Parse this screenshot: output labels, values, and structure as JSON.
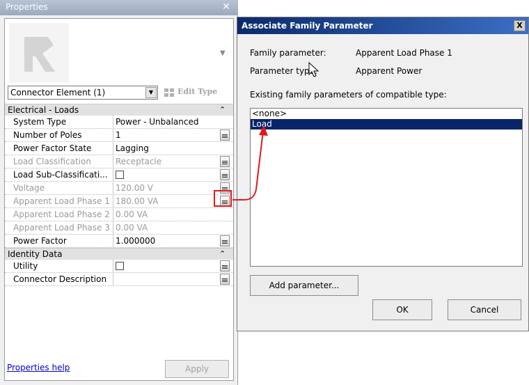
{
  "properties": {
    "title": "Properties",
    "close_glyph": "✕",
    "type_selector": "Connector Element (1)",
    "edit_type_label": "Edit Type",
    "groups": [
      {
        "label": "Electrical - Loads",
        "collapse_glyph": "⌃",
        "rows": [
          {
            "name": "System Type",
            "value": "Power - Unbalanced",
            "enabled": true,
            "has_button": false,
            "checkbox": false
          },
          {
            "name": "Number of Poles",
            "value": "1",
            "enabled": true,
            "has_button": true,
            "checkbox": false
          },
          {
            "name": "Power Factor State",
            "value": "Lagging",
            "enabled": true,
            "has_button": false,
            "checkbox": false
          },
          {
            "name": "Load Classification",
            "value": "Receptacle",
            "enabled": false,
            "has_button": true,
            "checkbox": false
          },
          {
            "name": "Load Sub-Classificati...",
            "value": "",
            "enabled": true,
            "has_button": true,
            "checkbox": true
          },
          {
            "name": "Voltage",
            "value": "120.00 V",
            "enabled": false,
            "has_button": true,
            "checkbox": false
          },
          {
            "name": "Apparent Load Phase 1",
            "value": "180.00 VA",
            "enabled": false,
            "has_button": true,
            "checkbox": false
          },
          {
            "name": "Apparent Load Phase 2",
            "value": "0.00 VA",
            "enabled": false,
            "has_button": false,
            "checkbox": false
          },
          {
            "name": "Apparent Load Phase 3",
            "value": "0.00 VA",
            "enabled": false,
            "has_button": false,
            "checkbox": false
          },
          {
            "name": "Power Factor",
            "value": "1.000000",
            "enabled": true,
            "has_button": true,
            "checkbox": false
          }
        ]
      },
      {
        "label": "Identity Data",
        "collapse_glyph": "⌃",
        "rows": [
          {
            "name": "Utility",
            "value": "",
            "enabled": true,
            "has_button": true,
            "checkbox": true
          },
          {
            "name": "Connector Description",
            "value": "",
            "enabled": true,
            "has_button": true,
            "checkbox": false
          }
        ]
      }
    ],
    "help_link": "Properties help",
    "apply_label": "Apply"
  },
  "dialog": {
    "title": "Associate Family Parameter",
    "close_glyph": "X",
    "family_parameter_label": "Family parameter:",
    "family_parameter_value": "Apparent Load Phase 1",
    "parameter_type_label": "Parameter type:",
    "parameter_type_value": "Apparent Power",
    "list_label": "Existing family parameters of compatible type:",
    "list_items": [
      "<none>",
      "Load"
    ],
    "selected_index": 1,
    "add_parameter_label": "Add parameter...",
    "ok_label": "OK",
    "cancel_label": "Cancel"
  },
  "colors": {
    "annotation": "#e31818",
    "selection": "#0a246a",
    "dialog_title_start": "#0b2a6b",
    "dialog_title_end": "#3b6fc4"
  }
}
